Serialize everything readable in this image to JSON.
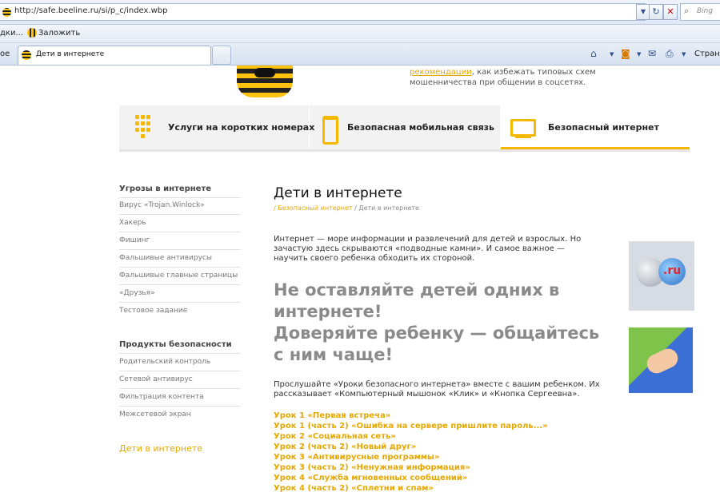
{
  "browser": {
    "url": "http://safe.beeline.ru/si/p_c/index.wbp",
    "search_placeholder": "Bing",
    "favorites_left": "дки...",
    "favorites_item": "Заложить",
    "tab_prev": "ое",
    "tab_active": "Дети в интернете",
    "toolbar_page": "Страни"
  },
  "promo": {
    "link": "рекомендации",
    "text": ", как избежать типовых схем мошенничества при общении в соцсетях."
  },
  "services": [
    {
      "label": "Услуги на коротких номерах",
      "icon": "keypad-icon"
    },
    {
      "label": "Безопасная мобильная связь",
      "icon": "phone-icon"
    },
    {
      "label": "Безопасный интернет",
      "icon": "monitor-icon"
    }
  ],
  "sidebar": {
    "threats_heading": "Угрозы в интернете",
    "threats": [
      "Вирус «Trojan.Winlock»",
      "Хакерь",
      "Фишинг",
      "Фальшивые антивирусы",
      "Фальшивые главные страницы",
      "«Друзья»",
      "Тестовое задание"
    ],
    "products_heading": "Продукты безопасности",
    "products": [
      "Родительский контроль",
      "Сетевой антивирус",
      "Фильтрация контента",
      "Межсетевой экран"
    ],
    "current": "Дети в интернете"
  },
  "main": {
    "title": "Дети в интернете",
    "breadcrumb_link": "/ Безопасный интернет",
    "breadcrumb_current": " / Дети в интернете",
    "intro": "Интернет — море информации и развлечений для детей и взрослых. Но зачастую здесь скрываются «подводные камни». И самое важное — научить своего ребенка обходить их стороной.",
    "headline_1": "Не оставляйте детей одних в интернете!",
    "headline_2": "Доверяйте ребенку — общайтесь с ним чаще!",
    "listen": "Прослушайте «Уроки безопасного интернета» вместе с вашим ребенком. Их рассказывает «Компьютерный мышонок «Клик» и «Кнопка Сергеевна».",
    "lessons": [
      "Урок 1 «Первая встреча»",
      "Урок 1 (часть 2) «Ошибка на сервере     пришлите пароль...»",
      "Урок 2 «Социальная сеть»",
      "Урок 2 (часть 2) «Новый друг»",
      "Урок 3 «Антивирусные программы»",
      "Урок 3 (часть 2) «Ненужная информация»",
      "Урок 4 «Служба мгновенных сообщений»",
      "Урок 4 (часть 2) «Сплетни и спам»"
    ]
  },
  "side_images": {
    "mailru_text": ".ru"
  },
  "colors": {
    "accent": "#f5b800",
    "link": "#e6a800",
    "headline": "#8a8a8a"
  }
}
